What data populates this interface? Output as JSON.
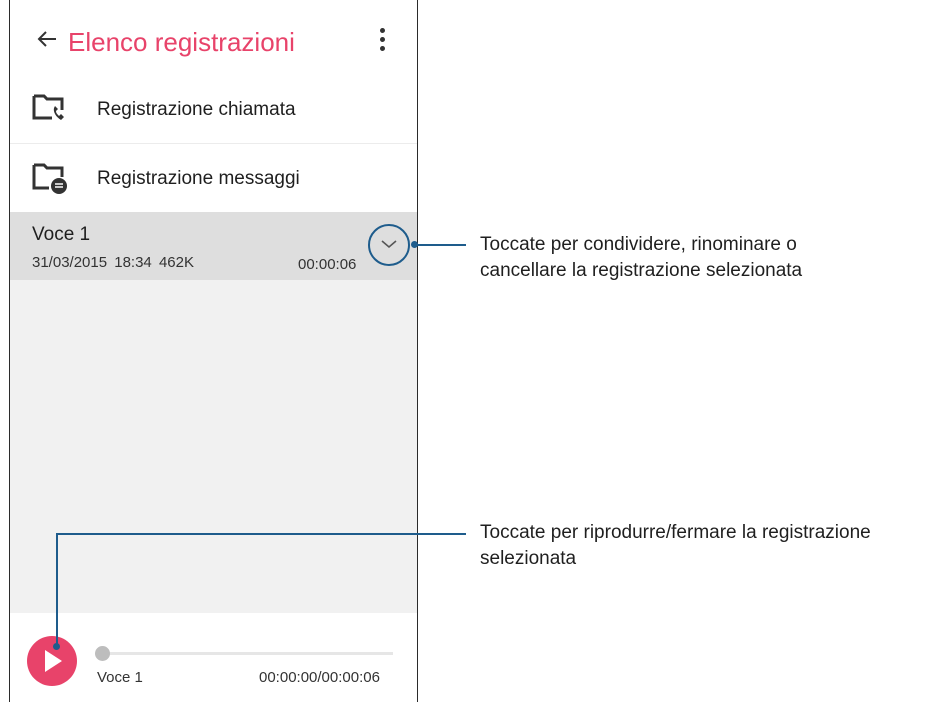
{
  "appbar": {
    "title": "Elenco registrazioni",
    "back_icon": "arrow-left-icon",
    "menu_icon": "more-vertical-icon"
  },
  "folders": [
    {
      "label": "Registrazione chiamata",
      "icon": "call-recording-folder-icon"
    },
    {
      "label": "Registrazione messaggi",
      "icon": "message-recording-folder-icon"
    }
  ],
  "recording": {
    "name": "Voce 1",
    "date": "31/03/2015 18:34",
    "size": "462K",
    "duration": "00:00:06",
    "expand_icon": "chevron-down-icon"
  },
  "player": {
    "name": "Voce 1",
    "time": "00:00:00/00:00:06",
    "progress": 0,
    "play_icon": "play-icon"
  },
  "callouts": {
    "expand_line1": "Toccate per condividere, rinominare o",
    "expand_line2": "cancellare la registrazione selezionata",
    "play_line1": "Toccate per riprodurre/fermare la registrazione",
    "play_line2": "selezionata"
  },
  "colors": {
    "accent": "#e8436a",
    "callout": "#1e5c8c",
    "selected_row": "#dedede",
    "background": "#f1f1f1"
  }
}
